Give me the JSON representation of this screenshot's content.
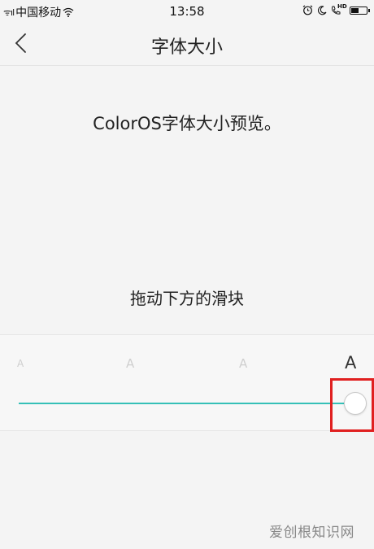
{
  "status_bar": {
    "signal": "ᯤıl",
    "carrier": "中国移动",
    "time": "13:58",
    "icons_right": [
      "alarm-icon",
      "do-not-disturb-icon",
      "hd-call-icon",
      "battery-icon"
    ],
    "hd_label": "HD",
    "battery_level": 0.5
  },
  "nav": {
    "title": "字体大小"
  },
  "preview": {
    "text": "ColorOS字体大小预览。"
  },
  "instruction": {
    "text": "拖动下方的滑块"
  },
  "slider": {
    "ticks": [
      "A",
      "A",
      "A",
      "A"
    ],
    "selected_index": 3,
    "accent_color": "#35c0b7"
  },
  "highlight": {
    "color": "#e02020"
  },
  "watermark": {
    "text": "爱创根知识网"
  }
}
